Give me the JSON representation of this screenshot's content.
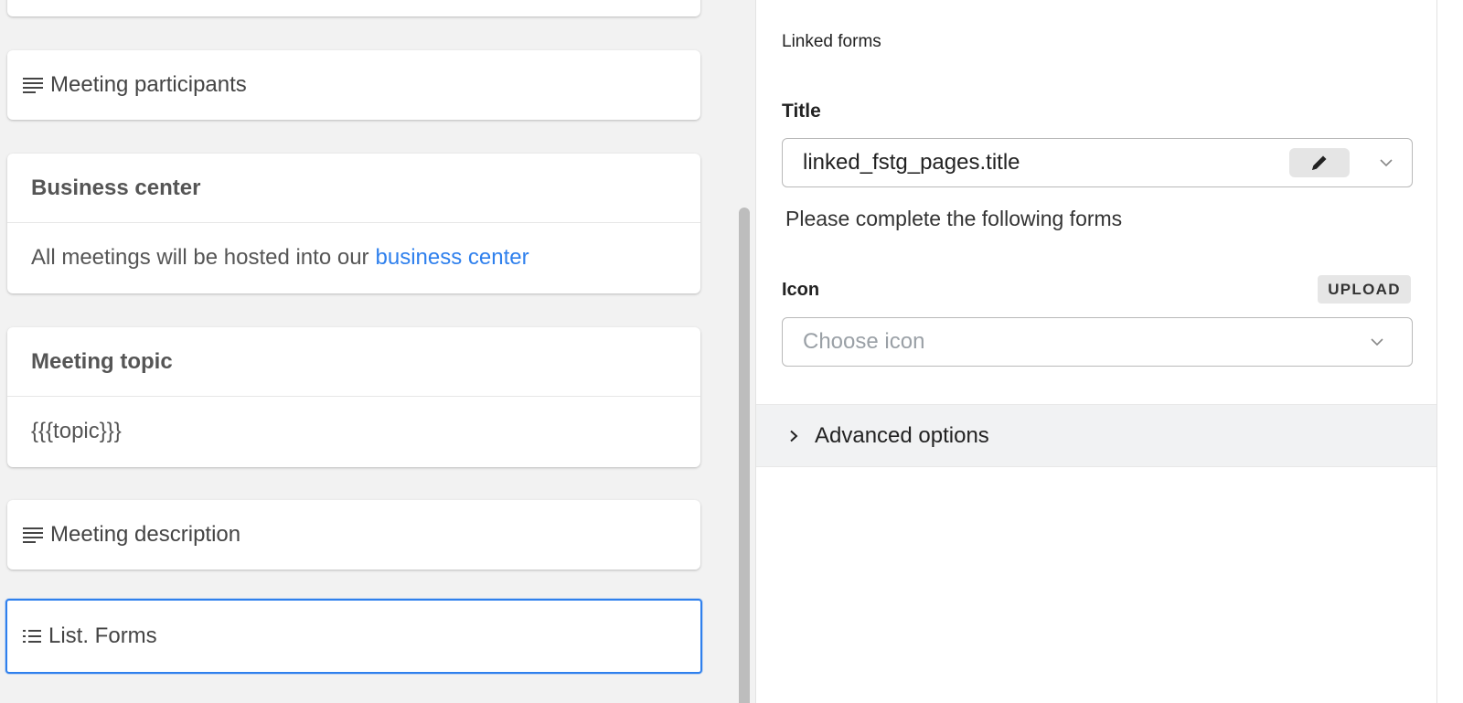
{
  "canvas": {
    "cards": {
      "meeting_participants": "Meeting participants",
      "business_center": {
        "title": "Business center",
        "body_text": "All meetings will be hosted into our",
        "link_text": "business center"
      },
      "meeting_topic": {
        "title": "Meeting topic",
        "body": "{{{topic}}}"
      },
      "meeting_description": "Meeting description",
      "list_forms": "List. Forms"
    }
  },
  "panel": {
    "section_title": "Linked forms",
    "title_field": {
      "label": "Title",
      "value": "linked_fstg_pages.title",
      "help": "Please complete the following forms"
    },
    "icon_field": {
      "label": "Icon",
      "upload_label": "UPLOAD",
      "placeholder": "Choose icon"
    },
    "advanced_label": "Advanced options"
  },
  "colors": {
    "accent": "#2f80ed",
    "canvas_bg": "#f2f2f2"
  }
}
